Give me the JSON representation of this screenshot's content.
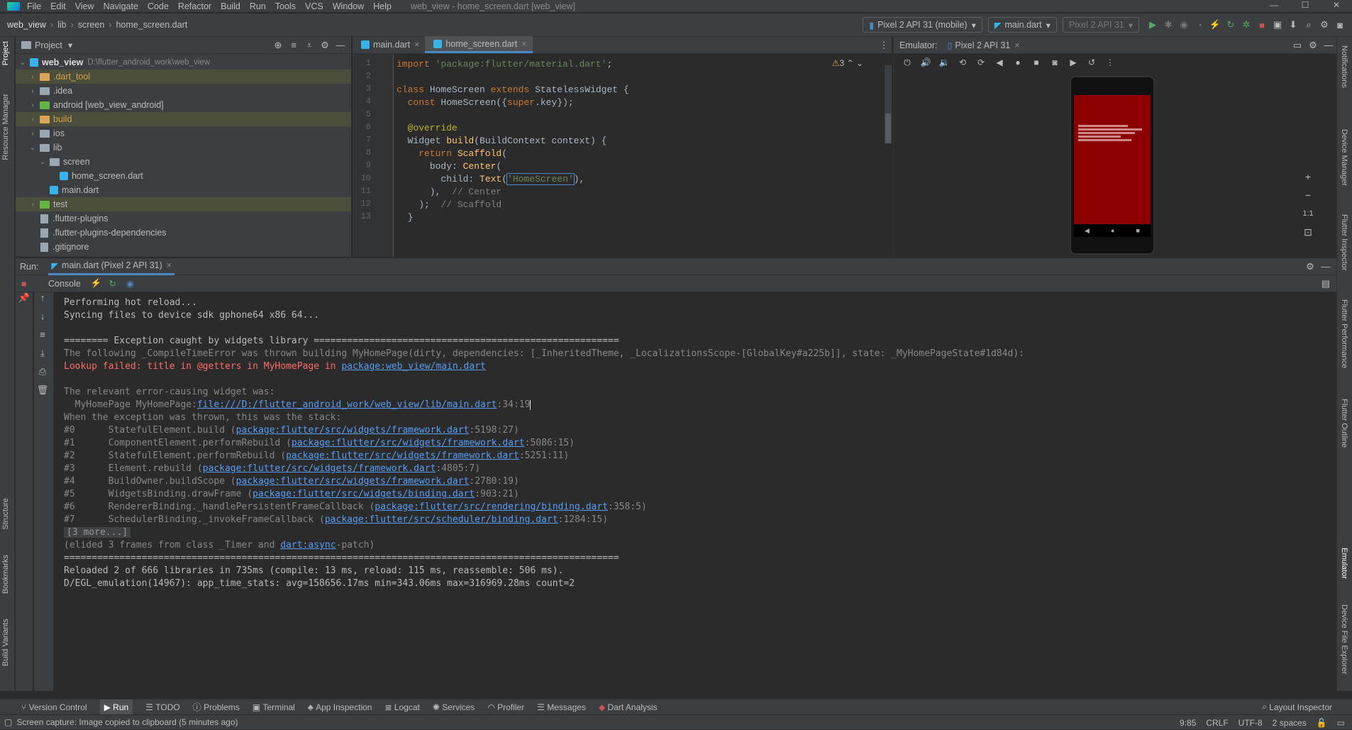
{
  "menubar": {
    "items": [
      "File",
      "Edit",
      "View",
      "Navigate",
      "Code",
      "Refactor",
      "Build",
      "Run",
      "Tools",
      "VCS",
      "Window",
      "Help"
    ],
    "window_title": "web_view - home_screen.dart [web_view]"
  },
  "navbar": {
    "breadcrumbs": [
      "web_view",
      "lib",
      "screen",
      "home_screen.dart"
    ],
    "device_combo": "Pixel 2 API 31 (mobile)",
    "config_combo": "main.dart",
    "device_combo2": "Pixel 2 API 31"
  },
  "left_tabs": [
    "Project",
    "Resource Manager",
    "Structure",
    "Bookmarks",
    "Build Variants"
  ],
  "right_tabs": [
    "Notifications",
    "Device Manager",
    "Flutter Inspector",
    "Flutter Performance",
    "Flutter Outline",
    "Emulator",
    "Device File Explorer"
  ],
  "project": {
    "title": "Project",
    "root_name": "web_view",
    "root_path": "D:\\flutter_android_work\\web_view",
    "tree": [
      {
        "label": ".dart_tool",
        "level": 1,
        "arrow": "›",
        "icon": "folder-orange",
        "excluded": true
      },
      {
        "label": ".idea",
        "level": 1,
        "arrow": "›",
        "icon": "folder"
      },
      {
        "label": "android [web_view_android]",
        "level": 1,
        "arrow": "›",
        "icon": "folder-green"
      },
      {
        "label": "build",
        "level": 1,
        "arrow": "›",
        "icon": "folder-orange",
        "excluded": true
      },
      {
        "label": "ios",
        "level": 1,
        "arrow": "›",
        "icon": "folder"
      },
      {
        "label": "lib",
        "level": 1,
        "arrow": "⌄",
        "icon": "folder"
      },
      {
        "label": "screen",
        "level": 2,
        "arrow": "⌄",
        "icon": "folder"
      },
      {
        "label": "home_screen.dart",
        "level": 3,
        "arrow": "",
        "icon": "dart"
      },
      {
        "label": "main.dart",
        "level": 2,
        "arrow": "",
        "icon": "dart"
      },
      {
        "label": "test",
        "level": 1,
        "arrow": "›",
        "icon": "folder-green",
        "excluded": true
      },
      {
        "label": ".flutter-plugins",
        "level": 1,
        "arrow": "",
        "icon": "file"
      },
      {
        "label": ".flutter-plugins-dependencies",
        "level": 1,
        "arrow": "",
        "icon": "file"
      },
      {
        "label": ".gitignore",
        "level": 1,
        "arrow": "",
        "icon": "file"
      }
    ]
  },
  "editor": {
    "tabs": [
      "main.dart",
      "home_screen.dart"
    ],
    "warning_count": "3",
    "lines": [
      {
        "n": "1",
        "html": "<span class='kw'>import </span><span class='str'>'package:flutter/material.dart'</span><span class='tx'>;</span>"
      },
      {
        "n": "2",
        "html": ""
      },
      {
        "n": "3",
        "html": "<span class='kw'>class </span><span class='tx'>HomeScreen </span><span class='kw'>extends </span><span class='tx'>StatelessWidget {</span>"
      },
      {
        "n": "4",
        "html": "<span class='tx'>  </span><span class='kw'>const </span><span class='tx'>HomeScreen({</span><span class='kw'>super</span><span class='tx'>.key});</span>"
      },
      {
        "n": "5",
        "html": ""
      },
      {
        "n": "6",
        "html": "<span class='ann'>  @override</span>"
      },
      {
        "n": "7",
        "html": "<span class='tx'>  Widget </span><span class='fn'>build</span><span class='tx'>(BuildContext context) {</span>"
      },
      {
        "n": "8",
        "html": "<span class='kw'>    return </span><span class='fn'>Scaffold</span><span class='tx'>(</span>"
      },
      {
        "n": "9",
        "html": "<span class='tx'>      body: </span><span class='fn'>Center</span><span class='tx'>(</span>"
      },
      {
        "n": "10",
        "html": "<span class='tx'>        child: </span><span class='fn'>Text</span><span class='tx'>(</span><span class='str' style='outline:1px solid #4a88c7'>'HomeScreen'</span><span class='tx'>),</span>"
      },
      {
        "n": "11",
        "html": "<span class='tx'>      ),  </span><span class='cm'>// Center</span>"
      },
      {
        "n": "12",
        "html": "<span class='tx'>    );  </span><span class='cm'>// Scaffold</span>"
      },
      {
        "n": "13",
        "html": "<span class='tx'>  }</span>"
      }
    ]
  },
  "emulator": {
    "label": "Emulator:",
    "tab": "Pixel 2 API 31",
    "zoom_label": "1:1"
  },
  "run": {
    "label": "Run:",
    "tab": "main.dart (Pixel 2 API 31)",
    "console_tab": "Console"
  },
  "console_lines": [
    {
      "html": "Performing hot reload..."
    },
    {
      "html": "Syncing files to device sdk gphone64 x86 64..."
    },
    {
      "html": ""
    },
    {
      "html": "======== Exception caught by widgets library ======================================================="
    },
    {
      "html": "<span class='grey'>The following _CompileTimeError was thrown building MyHomePage(dirty, dependencies: [_InheritedTheme, _LocalizationsScope-[GlobalKey#a225b]], state: _MyHomePageState#1d84d):</span>"
    },
    {
      "html": "<span class='red'>Lookup failed: title in @getters in MyHomePage in </span><span class='link'>package:web_view/main.dart</span>"
    },
    {
      "html": ""
    },
    {
      "html": "<span class='grey'>The relevant error-causing widget was:</span>"
    },
    {
      "html": "<span class='grey'>  MyHomePage MyHomePage:</span><span class='link'>file:///D:/flutter_android_work/web_view/lib/main.dart</span><span class='grey'>:34:19</span><span class='caret'></span>"
    },
    {
      "html": "<span class='grey'>When the exception was thrown, this was the stack:</span>"
    },
    {
      "html": "<span class='grey'>#0      StatefulElement.build (</span><span class='link'>package:flutter/src/widgets/framework.dart</span><span class='grey'>:5198:27)</span>"
    },
    {
      "html": "<span class='grey'>#1      ComponentElement.performRebuild (</span><span class='link'>package:flutter/src/widgets/framework.dart</span><span class='grey'>:5086:15)</span>"
    },
    {
      "html": "<span class='grey'>#2      StatefulElement.performRebuild (</span><span class='link'>package:flutter/src/widgets/framework.dart</span><span class='grey'>:5251:11)</span>"
    },
    {
      "html": "<span class='grey'>#3      Element.rebuild (</span><span class='link'>package:flutter/src/widgets/framework.dart</span><span class='grey'>:4805:7)</span>"
    },
    {
      "html": "<span class='grey'>#4      BuildOwner.buildScope (</span><span class='link'>package:flutter/src/widgets/framework.dart</span><span class='grey'>:2780:19)</span>"
    },
    {
      "html": "<span class='grey'>#5      WidgetsBinding.drawFrame (</span><span class='link'>package:flutter/src/widgets/binding.dart</span><span class='grey'>:903:21)</span>"
    },
    {
      "html": "<span class='grey'>#6      RendererBinding._handlePersistentFrameCallback (</span><span class='link'>package:flutter/src/rendering/binding.dart</span><span class='grey'>:358:5)</span>"
    },
    {
      "html": "<span class='grey'>#7      SchedulerBinding._invokeFrameCallback (</span><span class='link'>package:flutter/src/scheduler/binding.dart</span><span class='grey'>:1284:15)</span>"
    },
    {
      "html": "<span class='more'>[3 more...]</span>"
    },
    {
      "html": "<span class='grey'>(elided 3 frames from class _Timer and </span><span class='link'>dart:async</span><span class='grey'>-patch)</span>"
    },
    {
      "html": "===================================================================================================="
    },
    {
      "html": "Reloaded 2 of 666 libraries in 735ms (compile: 13 ms, reload: 115 ms, reassemble: 506 ms)."
    },
    {
      "html": "D/EGL_emulation(14967): app_time_stats: avg=158656.17ms min=343.06ms max=316969.28ms count=2"
    }
  ],
  "bottom_tools": [
    "Version Control",
    "Run",
    "TODO",
    "Problems",
    "Terminal",
    "App Inspection",
    "Logcat",
    "Services",
    "Profiler",
    "Messages",
    "Dart Analysis"
  ],
  "layout_inspector": "Layout Inspector",
  "status": {
    "message": "Screen capture: Image copied to clipboard (5 minutes ago)",
    "position": "9:85",
    "line_sep": "CRLF",
    "encoding": "UTF-8",
    "indent": "2 spaces"
  }
}
